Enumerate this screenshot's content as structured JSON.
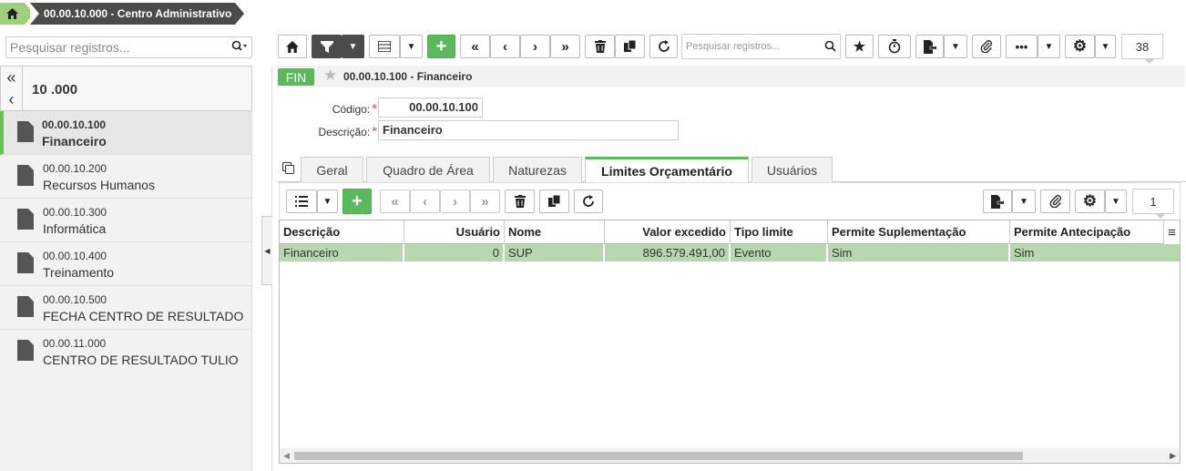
{
  "breadcrumb": {
    "item": "00.00.10.000 - Centro Administrativo"
  },
  "sidebar": {
    "search_placeholder": "Pesquisar registros...",
    "header_title": "10 .000",
    "items": [
      {
        "code": "00.00.10.100",
        "name": "Financeiro"
      },
      {
        "code": "00.00.10.200",
        "name": "Recursos Humanos"
      },
      {
        "code": "00.00.10.300",
        "name": "Informática"
      },
      {
        "code": "00.00.10.400",
        "name": "Treinamento"
      },
      {
        "code": "00.00.10.500",
        "name": "FECHA CENTRO DE RESULTADO"
      },
      {
        "code": "00.00.11.000",
        "name": "CENTRO DE RESULTADO TULIO"
      }
    ]
  },
  "toolbar": {
    "search_placeholder": "Pesquisar registros...",
    "record_count": "38"
  },
  "record": {
    "badge": "FIN",
    "title": "00.00.10.100 - Financeiro"
  },
  "form": {
    "codigo_label": "Código:",
    "codigo_value": "00.00.10.100",
    "descricao_label": "Descrição:",
    "descricao_value": "Financeiro",
    "required_mark": "*"
  },
  "tabs": [
    {
      "label": "Geral"
    },
    {
      "label": "Quadro de Área"
    },
    {
      "label": "Naturezas"
    },
    {
      "label": "Limites Orçamentário"
    },
    {
      "label": "Usuários"
    }
  ],
  "grid": {
    "record_count": "1",
    "columns": [
      "Descrição",
      "Usuário",
      "Nome",
      "Valor excedido",
      "Tipo limite",
      "Permite Suplementação",
      "Permite Antecipação"
    ],
    "rows": [
      {
        "descricao": "Financeiro",
        "usuario": "0",
        "nome": "SUP",
        "valor": "896.579.491,00",
        "tipo": "Evento",
        "suplementacao": "Sim",
        "antecipacao": "Sim"
      }
    ]
  },
  "icons": {
    "home": "home-icon",
    "filter": "filter-icon",
    "list": "list-icon",
    "add": "plus-icon",
    "first": "first-page-icon",
    "prev": "prev-icon",
    "next": "next-icon",
    "last": "last-page-icon",
    "delete": "trash-icon",
    "copy": "copy-icon",
    "refresh": "refresh-icon",
    "favorite": "star-icon",
    "timer": "stopwatch-icon",
    "export": "export-icon",
    "attach": "paperclip-icon",
    "more": "more-icon",
    "settings": "gear-icon"
  },
  "colors": {
    "accent_green": "#5cb85c",
    "selected_row": "#b8d7b0",
    "dark_button": "#4b4b4b"
  }
}
